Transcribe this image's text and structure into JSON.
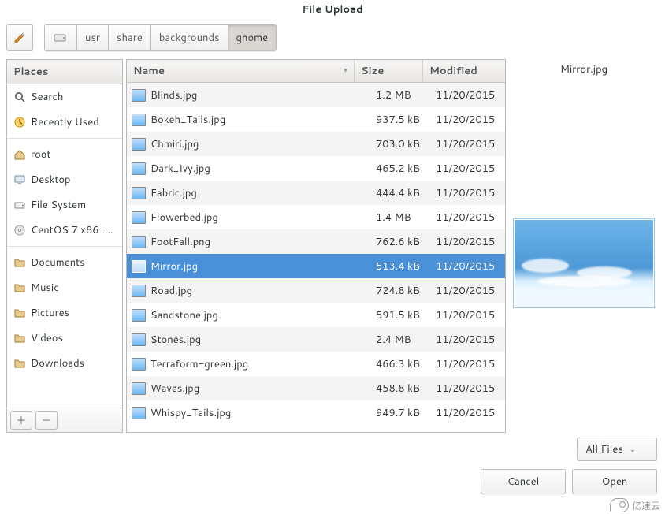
{
  "window": {
    "title": "File Upload"
  },
  "path": {
    "segments": [
      "usr",
      "share",
      "backgrounds",
      "gnome"
    ],
    "active_index": 3
  },
  "places": {
    "header": "Places",
    "items": [
      {
        "label": "Search",
        "icon": "search-icon"
      },
      {
        "label": "Recently Used",
        "icon": "clock-icon"
      },
      {
        "label": "root",
        "icon": "home-icon",
        "sep_before": true
      },
      {
        "label": "Desktop",
        "icon": "desktop-icon"
      },
      {
        "label": "File System",
        "icon": "drive-icon"
      },
      {
        "label": "CentOS 7 x86_...",
        "icon": "disc-icon"
      },
      {
        "label": "Documents",
        "icon": "folder-icon",
        "sep_before": true
      },
      {
        "label": "Music",
        "icon": "folder-icon"
      },
      {
        "label": "Pictures",
        "icon": "folder-icon"
      },
      {
        "label": "Videos",
        "icon": "folder-icon"
      },
      {
        "label": "Downloads",
        "icon": "folder-icon"
      }
    ]
  },
  "list": {
    "columns": {
      "name": "Name",
      "size": "Size",
      "modified": "Modified"
    },
    "sort_column": "name",
    "files": [
      {
        "name": "Blinds.jpg",
        "size": "1.2 MB",
        "modified": "11/20/2015"
      },
      {
        "name": "Bokeh_Tails.jpg",
        "size": "937.5 kB",
        "modified": "11/20/2015"
      },
      {
        "name": "Chmiri.jpg",
        "size": "703.0 kB",
        "modified": "11/20/2015"
      },
      {
        "name": "Dark_Ivy.jpg",
        "size": "465.2 kB",
        "modified": "11/20/2015"
      },
      {
        "name": "Fabric.jpg",
        "size": "444.4 kB",
        "modified": "11/20/2015"
      },
      {
        "name": "Flowerbed.jpg",
        "size": "1.4 MB",
        "modified": "11/20/2015"
      },
      {
        "name": "FootFall.png",
        "size": "762.6 kB",
        "modified": "11/20/2015"
      },
      {
        "name": "Mirror.jpg",
        "size": "513.4 kB",
        "modified": "11/20/2015",
        "selected": true
      },
      {
        "name": "Road.jpg",
        "size": "724.8 kB",
        "modified": "11/20/2015"
      },
      {
        "name": "Sandstone.jpg",
        "size": "591.5 kB",
        "modified": "11/20/2015"
      },
      {
        "name": "Stones.jpg",
        "size": "2.4 MB",
        "modified": "11/20/2015"
      },
      {
        "name": "Terraform-green.jpg",
        "size": "466.3 kB",
        "modified": "11/20/2015"
      },
      {
        "name": "Waves.jpg",
        "size": "458.8 kB",
        "modified": "11/20/2015"
      },
      {
        "name": "Whispy_Tails.jpg",
        "size": "949.7 kB",
        "modified": "11/20/2015"
      }
    ]
  },
  "preview": {
    "filename": "Mirror.jpg"
  },
  "filter": {
    "label": "All Files"
  },
  "buttons": {
    "cancel": "Cancel",
    "open": "Open"
  },
  "watermark": {
    "text": "亿速云"
  }
}
